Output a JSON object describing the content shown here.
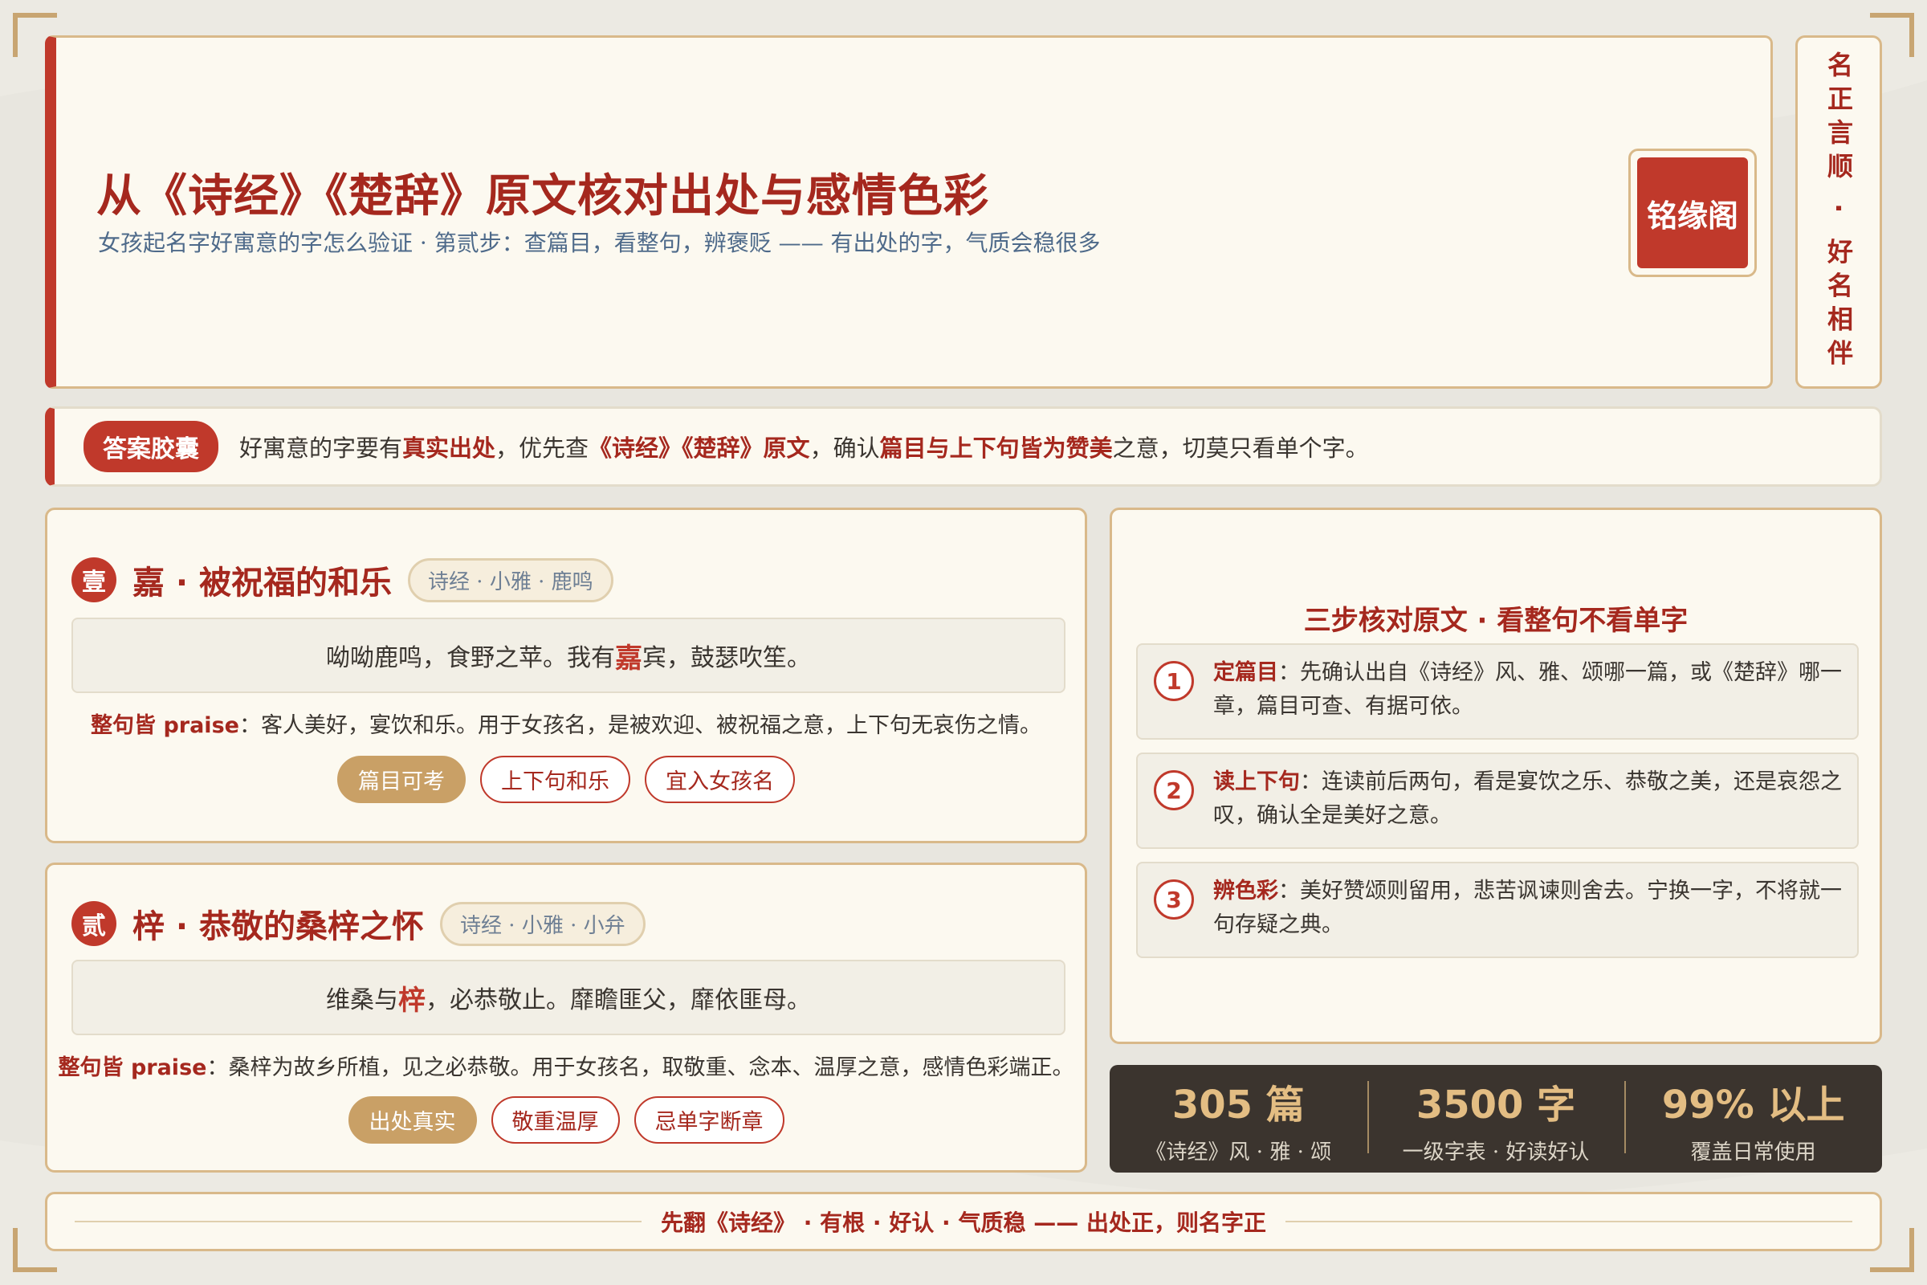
{
  "header": {
    "title": "从《诗经》《楚辞》原文核对出处与感情色彩",
    "subtitle": "女孩起名字好寓意的字怎么验证 · 第贰步：查篇目，看整句，辨褒贬 —— 有出处的字，气质会稳很多",
    "seal": "铭缘阁"
  },
  "side_motto": "名正言顺 · 好名相伴",
  "answer": {
    "badge": "答案胶囊",
    "t1": "好寓意的字要有",
    "b1": "真实出处",
    "t2": "，优先查",
    "b2": "《诗经》《楚辞》原文",
    "t3": "，确认",
    "b3": "篇目与上下句皆为赞美",
    "t4": "之意，切莫只看单个字。"
  },
  "cards": [
    {
      "num": "壹",
      "title": "嘉 · 被祝福的和乐",
      "source": "诗经 · 小雅 · 鹿鸣",
      "quote_pre": "呦呦鹿鸣，食野之苹。我有",
      "quote_hl": "嘉",
      "quote_post": "宾，鼓瑟吹笙。",
      "praise_label": "整句皆 praise",
      "praise_text": "：客人美好，宴饮和乐。用于女孩名，是被欢迎、被祝福之意，上下句无哀伤之情。",
      "tags": [
        "篇目可考",
        "上下句和乐",
        "宜入女孩名"
      ]
    },
    {
      "num": "贰",
      "title": "梓 · 恭敬的桑梓之怀",
      "source": "诗经 · 小雅 · 小弁",
      "quote_pre": "维桑与",
      "quote_hl": "梓",
      "quote_post": "，必恭敬止。靡瞻匪父，靡依匪母。",
      "praise_label": "整句皆 praise",
      "praise_text": "：桑梓为故乡所植，见之必恭敬。用于女孩名，取敬重、念本、温厚之意，感情色彩端正。",
      "tags": [
        "出处真实",
        "敬重温厚",
        "忌单字断章"
      ]
    }
  ],
  "steps": {
    "heading": "三步核对原文 · 看整句不看单字",
    "items": [
      {
        "num": "1",
        "label": "定篇目",
        "text": "：先确认出自《诗经》风、雅、颂哪一篇，或《楚辞》哪一章，篇目可查、有据可依。"
      },
      {
        "num": "2",
        "label": "读上下句",
        "text": "：连读前后两句，看是宴饮之乐、恭敬之美，还是哀怨之叹，确认全是美好之意。"
      },
      {
        "num": "3",
        "label": "辨色彩",
        "text": "：美好赞颂则留用，悲苦讽谏则舍去。宁换一字，不将就一句存疑之典。"
      }
    ]
  },
  "stats": [
    {
      "big": "305 篇",
      "small": "《诗经》风 · 雅 · 颂"
    },
    {
      "big": "3500 字",
      "small": "一级字表 · 好读好认"
    },
    {
      "big": "99% 以上",
      "small": "覆盖日常使用"
    }
  ],
  "footer": "先翻《诗经》 · 有根 · 好认 · 气质稳 —— 出处正，则名字正"
}
